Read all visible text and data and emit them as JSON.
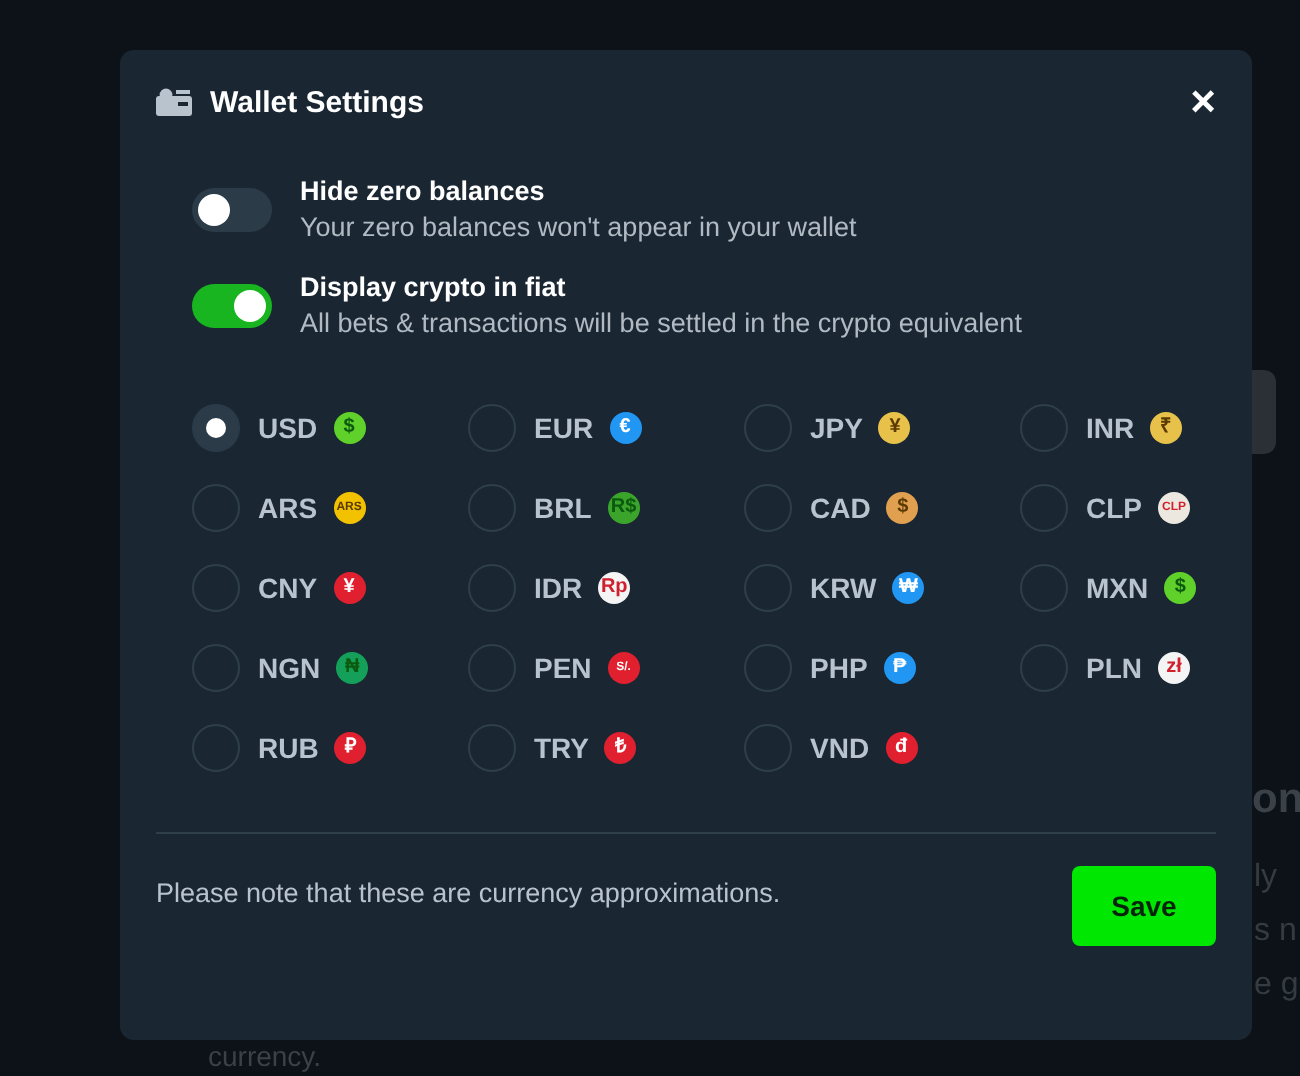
{
  "background": {
    "heading": "on",
    "lines": [
      "ly",
      "s n",
      "e g"
    ],
    "footer": "currency."
  },
  "dialog": {
    "title": "Wallet Settings",
    "close": "×",
    "toggles": [
      {
        "label": "Hide zero balances",
        "description": "Your zero balances won't appear in your wallet",
        "on": false
      },
      {
        "label": "Display crypto in fiat",
        "description": "All bets & transactions will be settled in the crypto equivalent",
        "on": true
      }
    ],
    "currencies": [
      {
        "code": "USD",
        "symbol": "$",
        "color": "#5fd12a",
        "selected": true
      },
      {
        "code": "EUR",
        "symbol": "€",
        "color": "#2196f3",
        "selected": false
      },
      {
        "code": "JPY",
        "symbol": "¥",
        "color": "#e8c14a",
        "selected": false
      },
      {
        "code": "INR",
        "symbol": "₹",
        "color": "#e8c14a",
        "selected": false
      },
      {
        "code": "ARS",
        "symbol": "ARS",
        "color": "#f2c200",
        "selected": false
      },
      {
        "code": "BRL",
        "symbol": "R$",
        "color": "#3aa52a",
        "selected": false
      },
      {
        "code": "CAD",
        "symbol": "$",
        "color": "#e0a050",
        "selected": false
      },
      {
        "code": "CLP",
        "symbol": "CLP",
        "color": "#ece8e0",
        "selected": false
      },
      {
        "code": "CNY",
        "symbol": "¥",
        "color": "#e0202e",
        "selected": false
      },
      {
        "code": "IDR",
        "symbol": "Rp",
        "color": "#f4f4f4",
        "selected": false
      },
      {
        "code": "KRW",
        "symbol": "₩",
        "color": "#2196f3",
        "selected": false
      },
      {
        "code": "MXN",
        "symbol": "$",
        "color": "#5fd12a",
        "selected": false
      },
      {
        "code": "NGN",
        "symbol": "₦",
        "color": "#15a05a",
        "selected": false
      },
      {
        "code": "PEN",
        "symbol": "S/.",
        "color": "#e0202e",
        "selected": false
      },
      {
        "code": "PHP",
        "symbol": "₱",
        "color": "#2196f3",
        "selected": false
      },
      {
        "code": "PLN",
        "symbol": "zł",
        "color": "#f4f4f4",
        "selected": false
      },
      {
        "code": "RUB",
        "symbol": "₽",
        "color": "#e0202e",
        "selected": false
      },
      {
        "code": "TRY",
        "symbol": "₺",
        "color": "#e0202e",
        "selected": false
      },
      {
        "code": "VND",
        "symbol": "đ",
        "color": "#e0202e",
        "selected": false
      }
    ],
    "note": "Please note that these are currency approximations.",
    "save": "Save"
  }
}
